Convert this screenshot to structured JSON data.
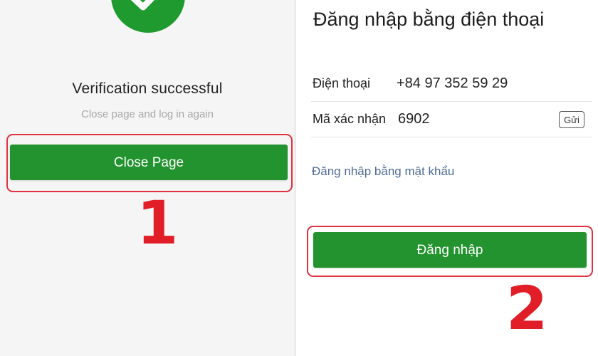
{
  "left": {
    "title": "Verification successful",
    "subtitle": "Close page and log in again",
    "close_button": "Close Page",
    "step": "1"
  },
  "right": {
    "title": "Đăng nhập bằng điện thoại",
    "phone_label": "Điện thoại",
    "phone_value": "+84 97 352 59 29",
    "code_label": "Mã xác nhận",
    "code_value": "6902",
    "send_button": "Gửi",
    "password_link": "Đăng nhập bằng mật khẩu",
    "login_button": "Đăng nhập",
    "step": "2"
  },
  "colors": {
    "green": "#22932e",
    "highlight": "#e0323f",
    "step_number": "#e11e27",
    "link": "#4d6b93"
  },
  "icons": {
    "success": "checkmark-icon"
  }
}
